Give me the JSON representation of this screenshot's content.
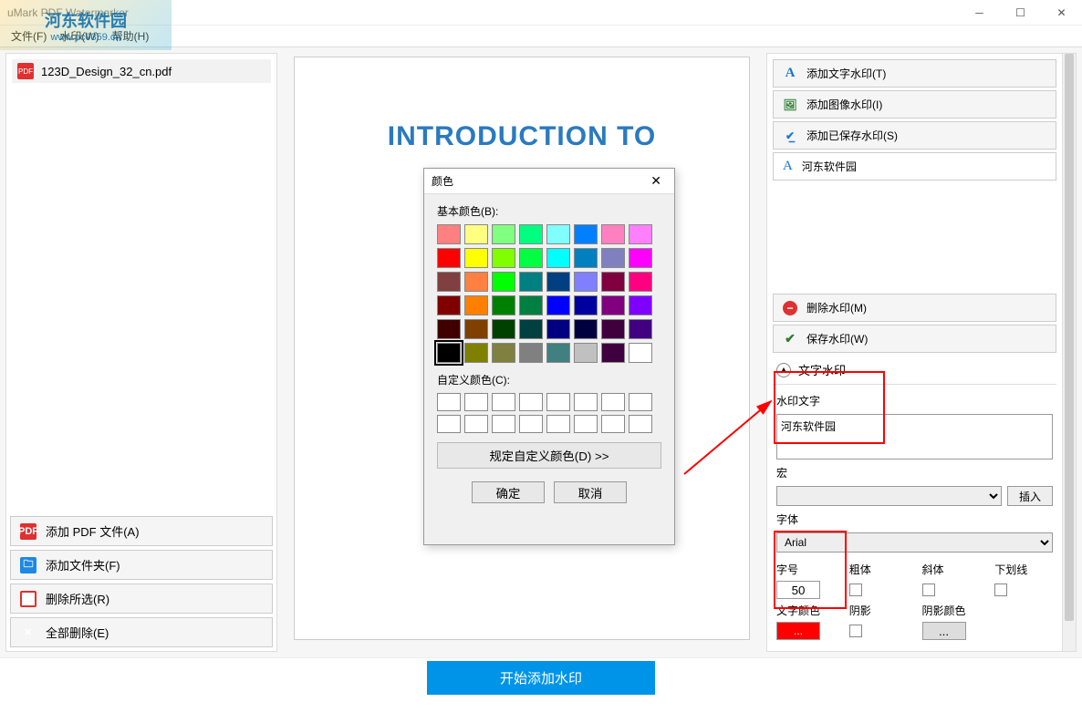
{
  "app": {
    "title": "uMark PDF Watermarker"
  },
  "menu": {
    "file": "文件(F)",
    "watermark": "水印(W)",
    "help": "帮助(H)"
  },
  "file_list": {
    "items": [
      {
        "name": "123D_Design_32_cn.pdf"
      }
    ]
  },
  "left_buttons": {
    "add_pdf": "添加 PDF 文件(A)",
    "add_folder": "添加文件夹(F)",
    "remove_sel": "删除所选(R)",
    "remove_all": "全部删除(E)"
  },
  "preview": {
    "heading": "INTRODUCTION TO"
  },
  "right": {
    "add_text": "添加文字水印(T)",
    "add_image": "添加图像水印(I)",
    "add_saved": "添加已保存水印(S)",
    "current_wm": "河东软件园",
    "delete_wm": "删除水印(M)",
    "save_wm": "保存水印(W)",
    "section": "文字水印",
    "wm_text_label": "水印文字",
    "wm_text_value": "河东软件园",
    "macro_label": "宏",
    "insert_btn": "插入",
    "font_label": "字体",
    "font_value": "Arial",
    "size_label": "字号",
    "size_value": "50",
    "bold": "粗体",
    "italic": "斜体",
    "underline": "下划线",
    "color_label": "文字颜色",
    "color_btn": "...",
    "shadow": "阴影",
    "shadow_color": "阴影颜色",
    "shadow_btn": "..."
  },
  "footer": {
    "start": "开始添加水印"
  },
  "dialog": {
    "title": "颜色",
    "basic_label": "基本颜色(B):",
    "custom_label": "自定义颜色(C):",
    "define_btn": "规定自定义颜色(D) >>",
    "ok": "确定",
    "cancel": "取消",
    "basic_colors": [
      "#ff8080",
      "#ffff80",
      "#80ff80",
      "#00ff80",
      "#80ffff",
      "#0080ff",
      "#ff80c0",
      "#ff80ff",
      "#ff0000",
      "#ffff00",
      "#80ff00",
      "#00ff40",
      "#00ffff",
      "#0080c0",
      "#8080c0",
      "#ff00ff",
      "#804040",
      "#ff8040",
      "#00ff00",
      "#008080",
      "#004080",
      "#8080ff",
      "#800040",
      "#ff0080",
      "#800000",
      "#ff8000",
      "#008000",
      "#008040",
      "#0000ff",
      "#0000a0",
      "#800080",
      "#8000ff",
      "#400000",
      "#804000",
      "#004000",
      "#004040",
      "#000080",
      "#000040",
      "#400040",
      "#400080",
      "#000000",
      "#808000",
      "#808040",
      "#808080",
      "#408080",
      "#c0c0c0",
      "#400040",
      "#ffffff"
    ]
  },
  "overlay": {
    "logo_text": "河东软件园",
    "logo_url": "www.pc0359.cn"
  }
}
